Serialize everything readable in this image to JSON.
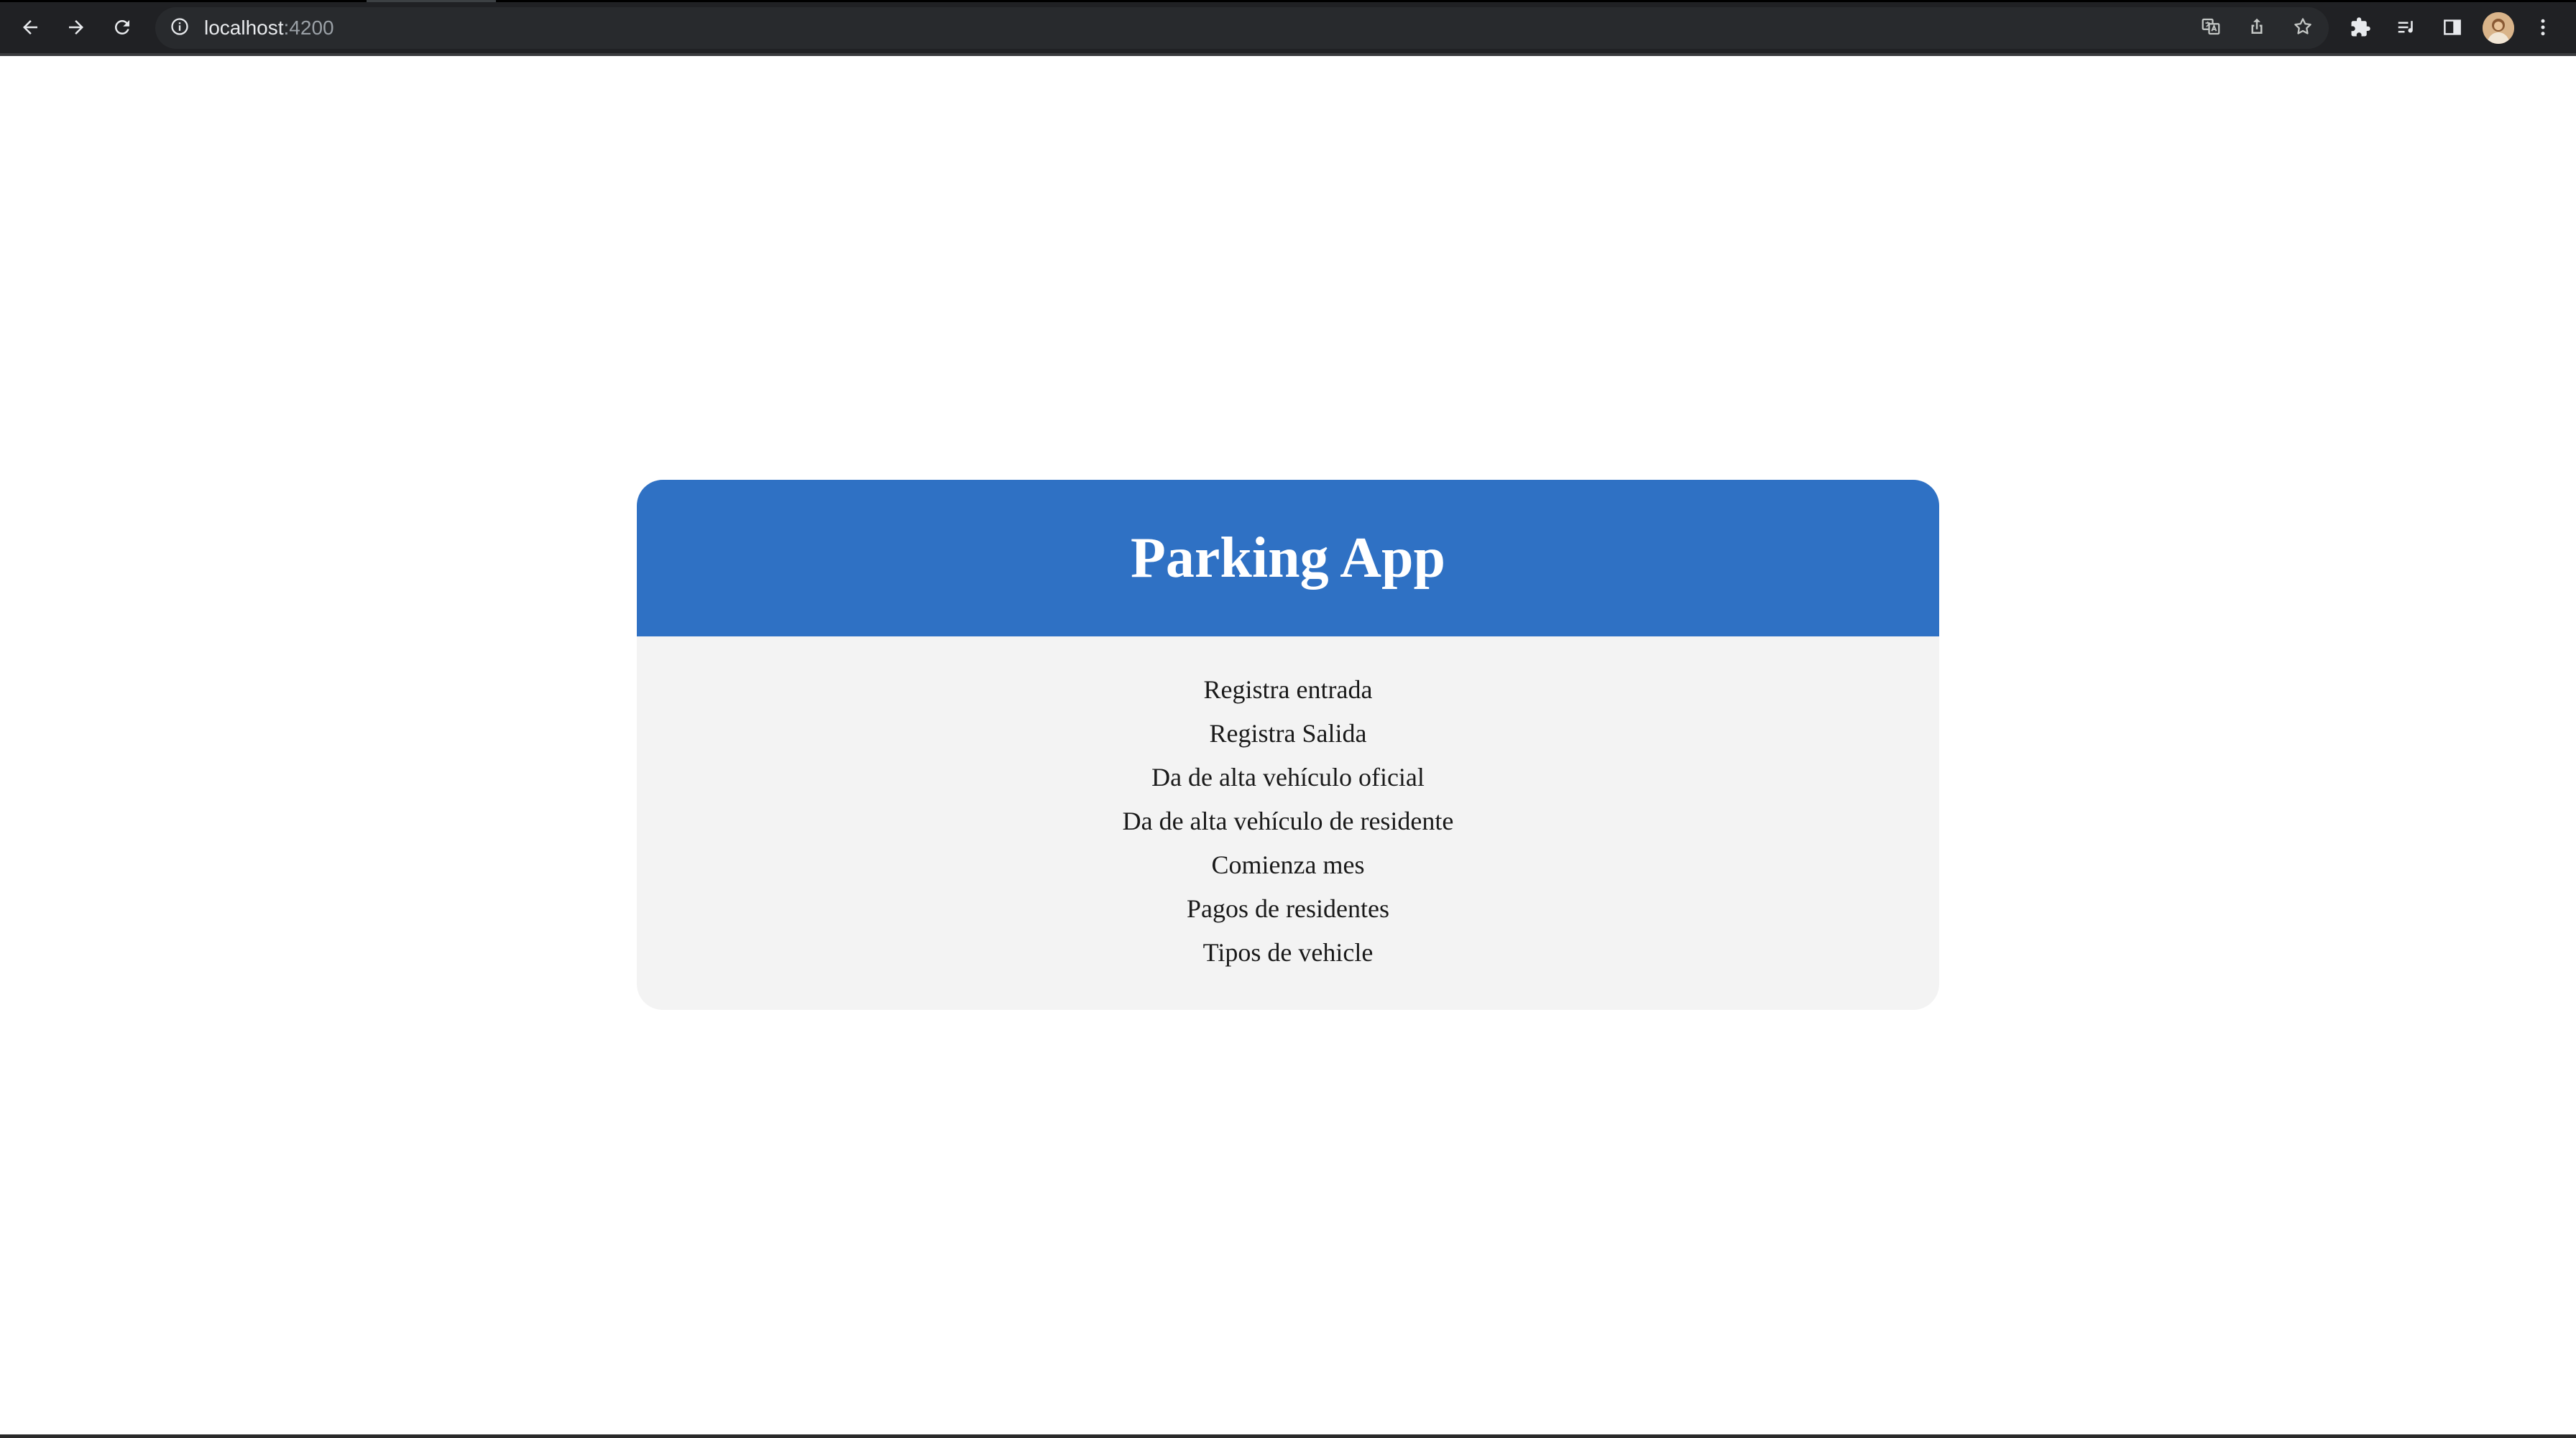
{
  "browser": {
    "url_host": "localhost",
    "url_port": ":4200",
    "icons": {
      "back": "arrow-left-icon",
      "forward": "arrow-right-icon",
      "reload": "reload-icon",
      "info": "info-icon",
      "translate": "translate-icon",
      "share": "share-icon",
      "bookmark": "star-icon",
      "extensions": "puzzle-icon",
      "reading_list": "reading-list-icon",
      "side_panel": "side-panel-icon",
      "profile": "avatar",
      "menu": "kebab-menu-icon"
    }
  },
  "app": {
    "title": "Parking App",
    "menu": [
      "Registra entrada",
      "Registra Salida",
      "Da de alta vehículo oficial",
      "Da de alta vehículo de residente",
      "Comienza mes",
      "Pagos de residentes",
      "Tipos de vehicle"
    ]
  },
  "colors": {
    "header_blue": "#2f71c4",
    "card_background": "#f3f3f3",
    "toolbar": "#202124"
  }
}
